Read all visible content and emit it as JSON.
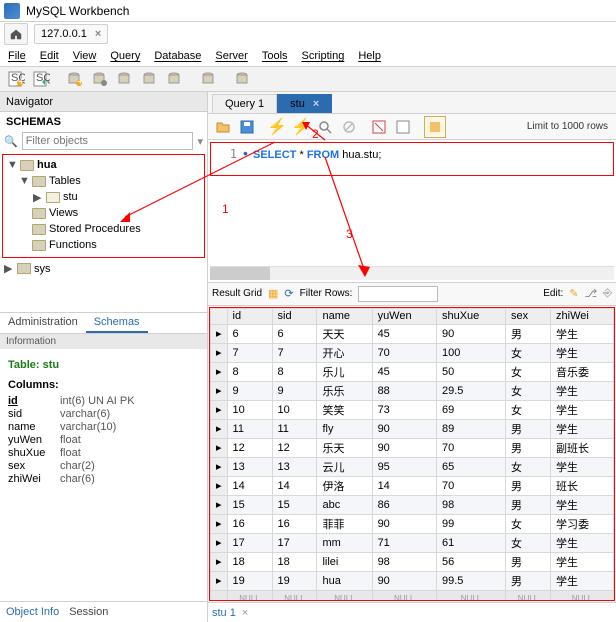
{
  "app": {
    "title": "MySQL Workbench"
  },
  "connection": {
    "name": "127.0.0.1"
  },
  "menu": [
    "File",
    "Edit",
    "View",
    "Query",
    "Database",
    "Server",
    "Tools",
    "Scripting",
    "Help"
  ],
  "nav": {
    "header": "Navigator",
    "schemas_label": "SCHEMAS",
    "filter_placeholder": "Filter objects",
    "tree": {
      "db": "hua",
      "folders": {
        "tables": "Tables",
        "views": "Views",
        "sprocs": "Stored Procedures",
        "funcs": "Functions"
      },
      "table": "stu",
      "sys": "sys"
    },
    "admin_tabs": {
      "t1": "Administration",
      "t2": "Schemas"
    }
  },
  "info": {
    "header": "Information",
    "table_label": "Table:",
    "table_name": "stu",
    "columns_label": "Columns:",
    "columns": [
      {
        "name": "id",
        "type": "int(6) UN AI PK",
        "key": true
      },
      {
        "name": "sid",
        "type": "varchar(6)"
      },
      {
        "name": "name",
        "type": "varchar(10)"
      },
      {
        "name": "yuWen",
        "type": "float"
      },
      {
        "name": "shuXue",
        "type": "float"
      },
      {
        "name": "sex",
        "type": "char(2)"
      },
      {
        "name": "zhiWei",
        "type": "char(6)"
      }
    ],
    "obj_tabs": {
      "t1": "Object Info",
      "t2": "Session"
    }
  },
  "editor": {
    "tabs": [
      {
        "label": "Query 1"
      },
      {
        "label": "stu"
      }
    ],
    "active": 1,
    "limit_label": "Limit to 1000 rows",
    "line_no": "1",
    "sql_kw1": "SELECT",
    "sql_star": " * ",
    "sql_kw2": "FROM",
    "sql_rest": " hua.stu;"
  },
  "annotations": {
    "a1": "1",
    "a2": "2",
    "a3": "3"
  },
  "result": {
    "toolbar": {
      "label": "Result Grid",
      "filter_label": "Filter Rows:",
      "edit_label": "Edit:"
    },
    "header": [
      "id",
      "sid",
      "name",
      "yuWen",
      "shuXue",
      "sex",
      "zhiWei"
    ],
    "rows": [
      [
        "6",
        "6",
        "天天",
        "45",
        "90",
        "男",
        "学生"
      ],
      [
        "7",
        "7",
        "开心",
        "70",
        "100",
        "女",
        "学生"
      ],
      [
        "8",
        "8",
        "乐儿",
        "45",
        "50",
        "女",
        "音乐委"
      ],
      [
        "9",
        "9",
        "乐乐",
        "88",
        "29.5",
        "女",
        "学生"
      ],
      [
        "10",
        "10",
        "笑笑",
        "73",
        "69",
        "女",
        "学生"
      ],
      [
        "11",
        "11",
        "fly",
        "90",
        "89",
        "男",
        "学生"
      ],
      [
        "12",
        "12",
        "乐天",
        "90",
        "70",
        "男",
        "副班长"
      ],
      [
        "13",
        "13",
        "云儿",
        "95",
        "65",
        "女",
        "学生"
      ],
      [
        "14",
        "14",
        "伊洛",
        "14",
        "70",
        "男",
        "班长"
      ],
      [
        "15",
        "15",
        "abc",
        "86",
        "98",
        "男",
        "学生"
      ],
      [
        "16",
        "16",
        "菲菲",
        "90",
        "99",
        "女",
        "学习委"
      ],
      [
        "17",
        "17",
        "mm",
        "71",
        "61",
        "女",
        "学生"
      ],
      [
        "18",
        "18",
        "lilei",
        "98",
        "56",
        "男",
        "学生"
      ],
      [
        "19",
        "19",
        "hua",
        "90",
        "99.5",
        "男",
        "学生"
      ]
    ],
    "null_label": "NULL",
    "res_tab": "stu 1"
  }
}
